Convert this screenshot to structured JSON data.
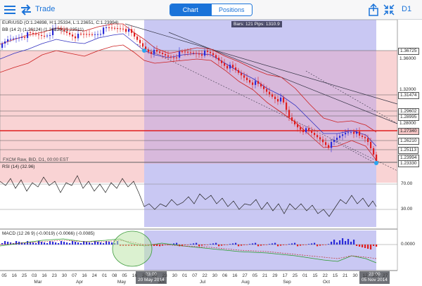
{
  "toolbar": {
    "title": "Trade",
    "tabs": [
      {
        "label": "Chart"
      },
      {
        "label": "Positions"
      }
    ],
    "timeframe": "D1",
    "accent_color": "#1a73d9"
  },
  "chart": {
    "symbol_info": "EUR/USD (O:1.24898, H:1.25334, L:1.23651, C:1.23994)",
    "bb_info": "BB (14 2) (1.26124) (1.24836) (1.23511)",
    "watermark": "FXCM Raw, BID, D1, 00:00 EST",
    "bars_info": "Bars: 121 Pips: 1310.9",
    "price_labels": [
      {
        "text": "1.36725",
        "boxed": true
      },
      {
        "text": "1.36000",
        "boxed": false
      },
      {
        "text": "1.32000",
        "boxed": false
      },
      {
        "text": "1.31474",
        "boxed": true
      },
      {
        "text": "1.29602",
        "boxed": true
      },
      {
        "text": "1.28995",
        "boxed": true
      },
      {
        "text": "1.28000",
        "boxed": false
      },
      {
        "text": "1.27340",
        "boxed": true
      },
      {
        "text": "1.26210",
        "boxed": true
      },
      {
        "text": "1.25113",
        "boxed": true
      },
      {
        "text": "1.23994",
        "boxed": true
      },
      {
        "text": "1.23330",
        "boxed": true
      }
    ],
    "rsi": {
      "label": "RSI (14) (32.96)",
      "levels": [
        "70.00",
        "30.00"
      ]
    },
    "macd": {
      "label": "MACD (12 26 9) (-0.0019) (-0.0066) (-0.0085)",
      "zero": "0.0000"
    },
    "date_tags": [
      {
        "time": "23:00",
        "date": "20 May 2014"
      },
      {
        "time": "23:00",
        "date": "05 Nov 2014"
      }
    ],
    "x_ticks": [
      "05",
      "16",
      "25",
      "03",
      "16",
      "23",
      "30",
      "07",
      "16",
      "24",
      "01",
      "08",
      "05",
      "16",
      "24",
      "20",
      "23",
      "30",
      "01",
      "07",
      "22",
      "30",
      "06",
      "16",
      "27",
      "05",
      "21",
      "29",
      "17",
      "25",
      "01",
      "15",
      "22",
      "15",
      "21",
      "30",
      "12",
      "20",
      "27"
    ],
    "x_months": [
      "Mar",
      "Apr",
      "May",
      "Jun",
      "Jul",
      "Aug",
      "Sep",
      "Oct"
    ],
    "colors": {
      "red_zone": "#f9d3d4",
      "blue_zone": "#c9c8f3",
      "purple_zone": "#d8b9dc",
      "bull": "#2b2bd8",
      "bear": "#e01e1e"
    }
  }
}
